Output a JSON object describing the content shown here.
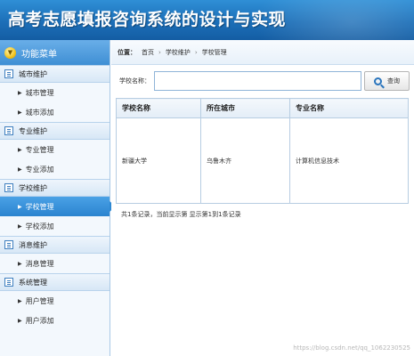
{
  "header": {
    "title": "高考志愿填报咨询系统的设计与实现"
  },
  "sidebar": {
    "menu_title": "功能菜单",
    "groups": [
      {
        "label": "城市维护",
        "items": [
          "城市管理",
          "城市添加"
        ]
      },
      {
        "label": "专业维护",
        "items": [
          "专业管理",
          "专业添加"
        ]
      },
      {
        "label": "学校维护",
        "items": [
          "学校管理",
          "学校添加"
        ]
      },
      {
        "label": "消息维护",
        "items": [
          "消息管理"
        ]
      },
      {
        "label": "系统管理",
        "items": [
          "用户管理",
          "用户添加"
        ]
      }
    ],
    "active_item": "学校管理"
  },
  "breadcrumb": {
    "label": "位置：",
    "items": [
      "首页",
      "学校维护",
      "学校管理"
    ],
    "separator": "›"
  },
  "search": {
    "label": "学校名称：",
    "value": "",
    "button_label": "查询"
  },
  "table": {
    "columns": [
      "学校名称",
      "所在城市",
      "专业名称"
    ],
    "rows": [
      [
        "新疆大学",
        "乌鲁木齐",
        "计算机信息技术"
      ]
    ]
  },
  "pagination": {
    "info": "共1条记录，当前显示第  显示第1到1条记录"
  },
  "watermark": "https://blog.csdn.net/qq_1062230525",
  "colors": {
    "header_top": "#2f8fd6",
    "header_bottom": "#145da3",
    "active_item": "#2b84d0",
    "border": "#b7cde2"
  }
}
